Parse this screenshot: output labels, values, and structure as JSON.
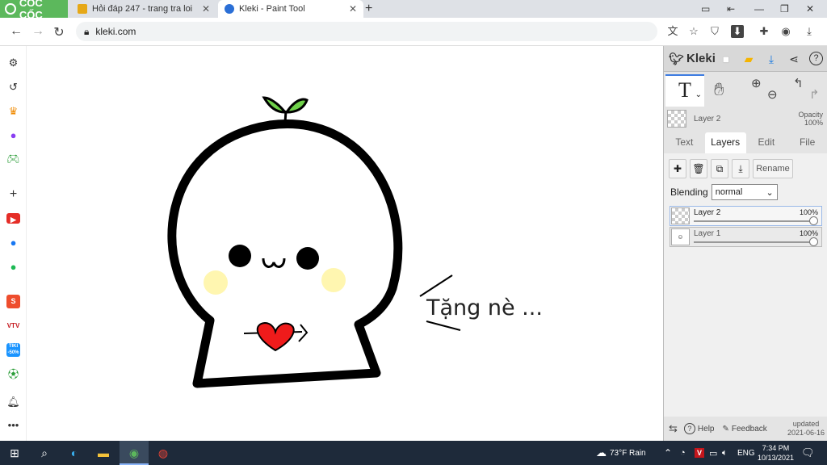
{
  "browser": {
    "brand_name": "CỐC CỐC",
    "tabs": [
      {
        "title": "Hỏi đáp 247 - trang tra loi",
        "favicon_color": "#e6a817"
      },
      {
        "title": "Kleki - Paint Tool",
        "favicon_color": "#2b6fd6"
      }
    ],
    "new_tab": "+",
    "address": "kleki.com"
  },
  "sidebar": {
    "items": [
      "gear-icon",
      "history-icon",
      "crown-icon",
      "messenger-icon",
      "game-icon",
      "add-icon",
      "youtube-icon",
      "facebook-icon",
      "spotify-icon",
      "shopee-icon",
      "vtv-icon",
      "tiki-icon",
      "football-icon",
      "bell-icon",
      "more-icon"
    ],
    "tiki_label": "TIKI -50%",
    "vtv_label": "VTV"
  },
  "drawing": {
    "caption": "Tặng nè ..."
  },
  "kleki": {
    "logo": "Kleki",
    "active_tool": "T",
    "layer_name": "Layer 2",
    "opacity_label": "Opacity",
    "opacity_value": "100%",
    "tabs": [
      "Text",
      "Layers",
      "Edit",
      "File"
    ],
    "active_tab": "Layers",
    "rename_label": "Rename",
    "blending_label": "Blending",
    "blending_value": "normal",
    "layers": [
      {
        "name": "Layer 2",
        "opacity": "100%",
        "opacity_fraction": 1.0
      },
      {
        "name": "Layer 1",
        "opacity": "100%",
        "opacity_fraction": 1.0
      }
    ],
    "footer": {
      "help": "Help",
      "feedback": "Feedback",
      "updated_label": "updated",
      "updated_date": "2021-06-16"
    }
  },
  "taskbar": {
    "weather": "73°F  Rain",
    "language": "ENG",
    "time": "7:34 PM",
    "date": "10/13/2021"
  }
}
